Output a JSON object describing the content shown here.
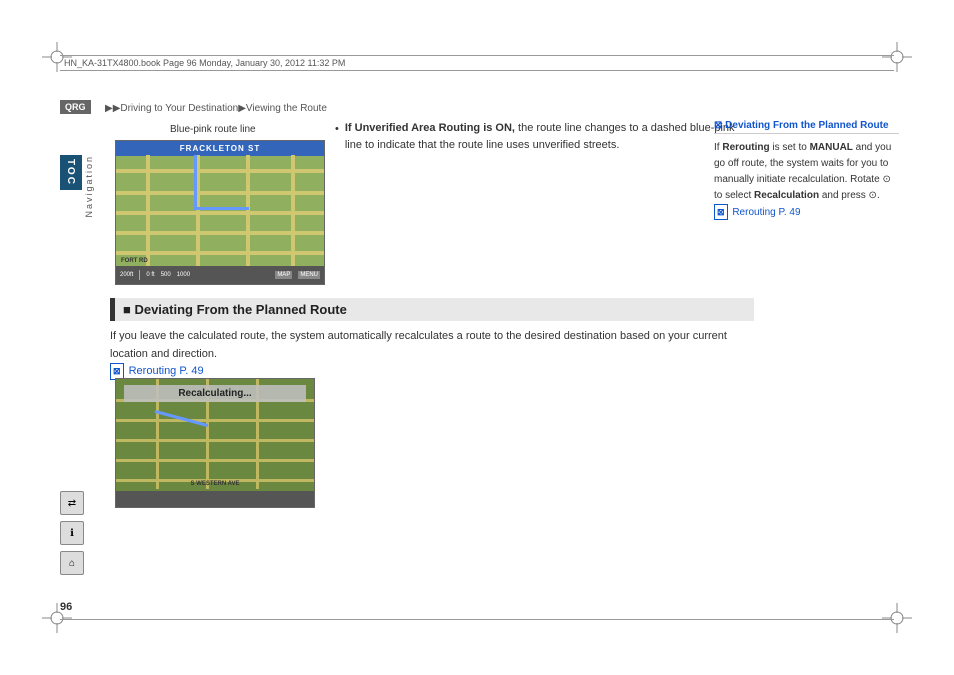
{
  "page": {
    "number": "96",
    "file_info": "HN_KA-31TX4800.book  Page 96  Monday, January 30, 2012  11:32 PM"
  },
  "breadcrumb": {
    "text": "▶▶Driving to Your Destination▶Viewing the Route"
  },
  "qrg": {
    "label": "QRG"
  },
  "toc": {
    "label": "TOC"
  },
  "nav_label": "Navigation",
  "blue_pink_label": "Blue-pink route line",
  "bullet_section": {
    "item1": {
      "bold_start": "If Unverified Area Routing",
      "bold_end": " is ON,",
      "text": " the route line changes to a dashed blue-pink line to indicate that the route line uses unverified streets."
    }
  },
  "section_heading": "■ Deviating From the Planned Route",
  "body_text": {
    "paragraph": "If you leave the calculated route, the system automatically recalculates a route to the desired destination based on your current location and direction.",
    "link_label": "Rerouting",
    "link_page": "P. 49"
  },
  "recalculating_text": "Recalculating...",
  "right_column": {
    "title": "⊠ Deviating From the Planned Route",
    "body": "If ",
    "rerouting_bold": "Rerouting",
    "body2": " is set to ",
    "manual_bold": "MANUAL",
    "body3": " and you go off route, the system waits for you to manually initiate recalculation. Rotate ",
    "rotate_icon": "⊙",
    "body4": " to select ",
    "recalculation_bold": "Recalculation",
    "body5": " and press ",
    "press_icon": "⊙",
    "body6": ".",
    "link_label": "Rerouting",
    "link_page": "P. 49"
  },
  "bottom_icons": {
    "icon1": "⇄",
    "icon2": "ℹ",
    "icon3": "⌂"
  },
  "map1": {
    "street_label": "FRACKLETON ST",
    "scale_200": "200ft",
    "scale_0": "0 ft",
    "scale_500": "500",
    "scale_1000": "1000",
    "fort_rd": "FORT RD",
    "map_btn": "MAP",
    "menu_btn": "MENU"
  },
  "map2": {
    "s_western": "S WESTERN AVE"
  }
}
